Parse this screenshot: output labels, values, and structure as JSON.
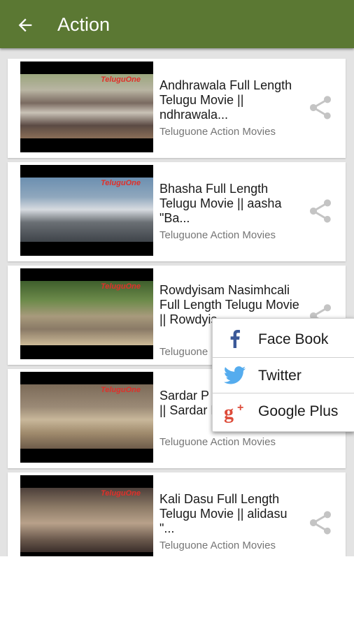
{
  "appbar": {
    "title": "Action"
  },
  "videos": [
    {
      "title": "Andhrawala Full Length Telugu Movie || ndhrawala...",
      "channel": "Teluguone Action Movies"
    },
    {
      "title": "Bhasha Full Length Telugu Movie || aasha \"Ba...",
      "channel": "Teluguone Action Movies"
    },
    {
      "title": "Rowdyisam Nasimhcali Full Length Telugu Movie || Rowdyis",
      "channel": "Teluguone"
    },
    {
      "title": "Sardar P Full Leng Movie || Sardar P...",
      "channel": "Teluguone Action Movies"
    },
    {
      "title": "Kali Dasu Full Length Telugu Movie || alidasu \"...",
      "channel": "Teluguone Action Movies"
    }
  ],
  "thumb_logo": "TeluguOne",
  "share_menu": {
    "items": [
      {
        "label": "Face Book",
        "icon": "facebook-icon"
      },
      {
        "label": "Twitter",
        "icon": "twitter-icon"
      },
      {
        "label": "Google Plus",
        "icon": "google-plus-icon"
      }
    ]
  },
  "colors": {
    "appbar": "#5b7833",
    "facebook": "#3b5998",
    "twitter": "#55acee",
    "google_plus": "#dd4b39"
  }
}
